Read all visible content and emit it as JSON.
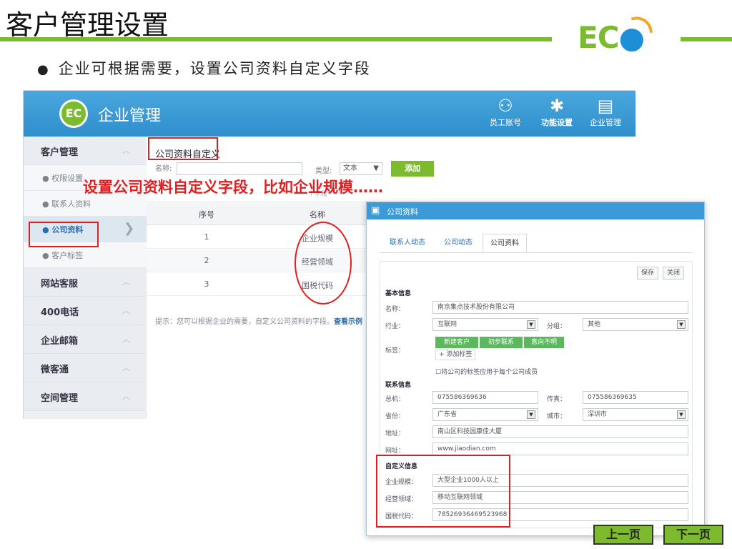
{
  "slide": {
    "title": "客户管理设置",
    "logo_text_a": "EC",
    "logo_text_b": "",
    "bullet": "企业可根据需要，设置公司资料自定义字段",
    "annotation": "设置公司资料自定义字段，比如企业规模……"
  },
  "app": {
    "title": "企业管理",
    "logo_text": "EC",
    "nav": [
      {
        "label": "员工账号",
        "icon": "users-icon"
      },
      {
        "label": "功能设置",
        "icon": "gear-icon"
      },
      {
        "label": "企业管理",
        "icon": "ledger-icon"
      }
    ],
    "sidebar": {
      "groups": [
        "客户管理",
        "网站客服",
        "400电话",
        "企业邮箱",
        "微客通",
        "空间管理"
      ],
      "items": [
        "● 权限设置",
        "● 联系人资料",
        "● 公司资料",
        "● 客户标签"
      ]
    },
    "content": {
      "title": "公司资料自定义",
      "name_label": "名称:",
      "type_label": "类型:",
      "type_value": "文本",
      "add_button": "添加",
      "hidden_hint": "个字段",
      "table": {
        "headers": [
          "序号",
          "名称"
        ],
        "rows": [
          [
            "1",
            "企业规模"
          ],
          [
            "2",
            "经营领域"
          ],
          [
            "3",
            "国税代码"
          ]
        ]
      },
      "tip_text": "提示：您可以根据企业的需要，自定义公司资料的字段。",
      "tip_link": "查看示例"
    }
  },
  "dialog": {
    "title": "公司资料",
    "tabs": [
      "联系人动态",
      "公司动态",
      "公司资料"
    ],
    "save_button": "保存",
    "close_button": "关闭",
    "basic_section": "基本信息",
    "name_label": "名称：",
    "name_value": "南京集点技术股份有限公司",
    "industry_label": "行业：",
    "industry_value": "互联网",
    "group_label": "分组：",
    "group_value": "其他",
    "tags_label": "标签：",
    "tags": [
      "新建客户",
      "初步联系",
      "意向不明"
    ],
    "add_tag": "+ 添加标签",
    "apply_tags": "将公司的标签应用于每个公司成员",
    "contact_section": "联系信息",
    "phone_label": "总机：",
    "phone_value": "075586369636",
    "fax_label": "传真：",
    "fax_value": "075586369635",
    "province_label": "省份：",
    "province_value": "广东省",
    "city_label": "城市：",
    "city_value": "深圳市",
    "address_label": "地址：",
    "address_value": "南山区科技园康佳大厦",
    "website_label": "网址：",
    "website_value": "www.jiaodian.com",
    "custom_section": "自定义信息",
    "scale_label": "企业规模：",
    "scale_value": "大型企业1000人以上",
    "field_label": "经营领域：",
    "field_value": "移动互联网领域",
    "tax_label": "国税代码：",
    "tax_value": "78526936469523968"
  },
  "pager": {
    "prev": "上一页",
    "next": "下一页"
  }
}
